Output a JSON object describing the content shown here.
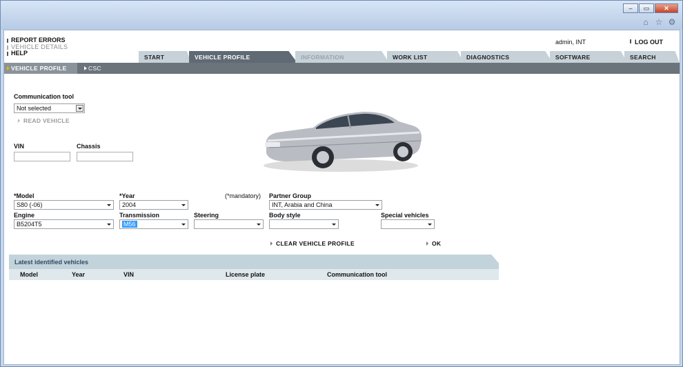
{
  "window": {
    "buttons": {
      "minimize": "–",
      "maximize": "▭",
      "close": "✕"
    },
    "tool_icons": [
      "home-icon",
      "favorites-icon",
      "settings-icon"
    ]
  },
  "toplinks": [
    "REPORT ERRORS",
    "VEHICLE DETAILS",
    "HELP"
  ],
  "user": "admin, INT",
  "logout": "LOG OUT",
  "tabs": [
    "START",
    "VEHICLE PROFILE",
    "INFORMATION",
    "WORK LIST",
    "DIAGNOSTICS",
    "SOFTWARE",
    "SEARCH"
  ],
  "subtabs": [
    "VEHICLE PROFILE",
    "CSC"
  ],
  "comm_tool": {
    "label": "Communication tool",
    "value": "Not selected",
    "read_vehicle": "READ VEHICLE"
  },
  "vin": {
    "label": "VIN",
    "value": ""
  },
  "chassis": {
    "label": "Chassis",
    "value": ""
  },
  "mandatory_note": "(*mandatory)",
  "fields": {
    "model": {
      "label": "*Model",
      "value": "S80 (-06)"
    },
    "year": {
      "label": "*Year",
      "value": "2004"
    },
    "partner_group": {
      "label": "Partner Group",
      "value": "INT, Arabia and China"
    },
    "engine": {
      "label": "Engine",
      "value": "B5204T5"
    },
    "transmission": {
      "label": "Transmission",
      "value": "M56"
    },
    "steering": {
      "label": "Steering",
      "value": ""
    },
    "body_style": {
      "label": "Body style",
      "value": ""
    },
    "special_vehicles": {
      "label": "Special vehicles",
      "value": ""
    }
  },
  "actions": {
    "clear": "CLEAR VEHICLE PROFILE",
    "ok": "OK"
  },
  "latest": {
    "title": "Latest identified vehicles",
    "columns": [
      "Model",
      "Year",
      "VIN",
      "License plate",
      "Communication tool"
    ]
  },
  "colors": {
    "active_tab": "#5f6a74",
    "tab": "#c6d1d8",
    "subbar": "#6b737b",
    "table_header": "#dfe8ec",
    "highlight": "#3399ff"
  }
}
